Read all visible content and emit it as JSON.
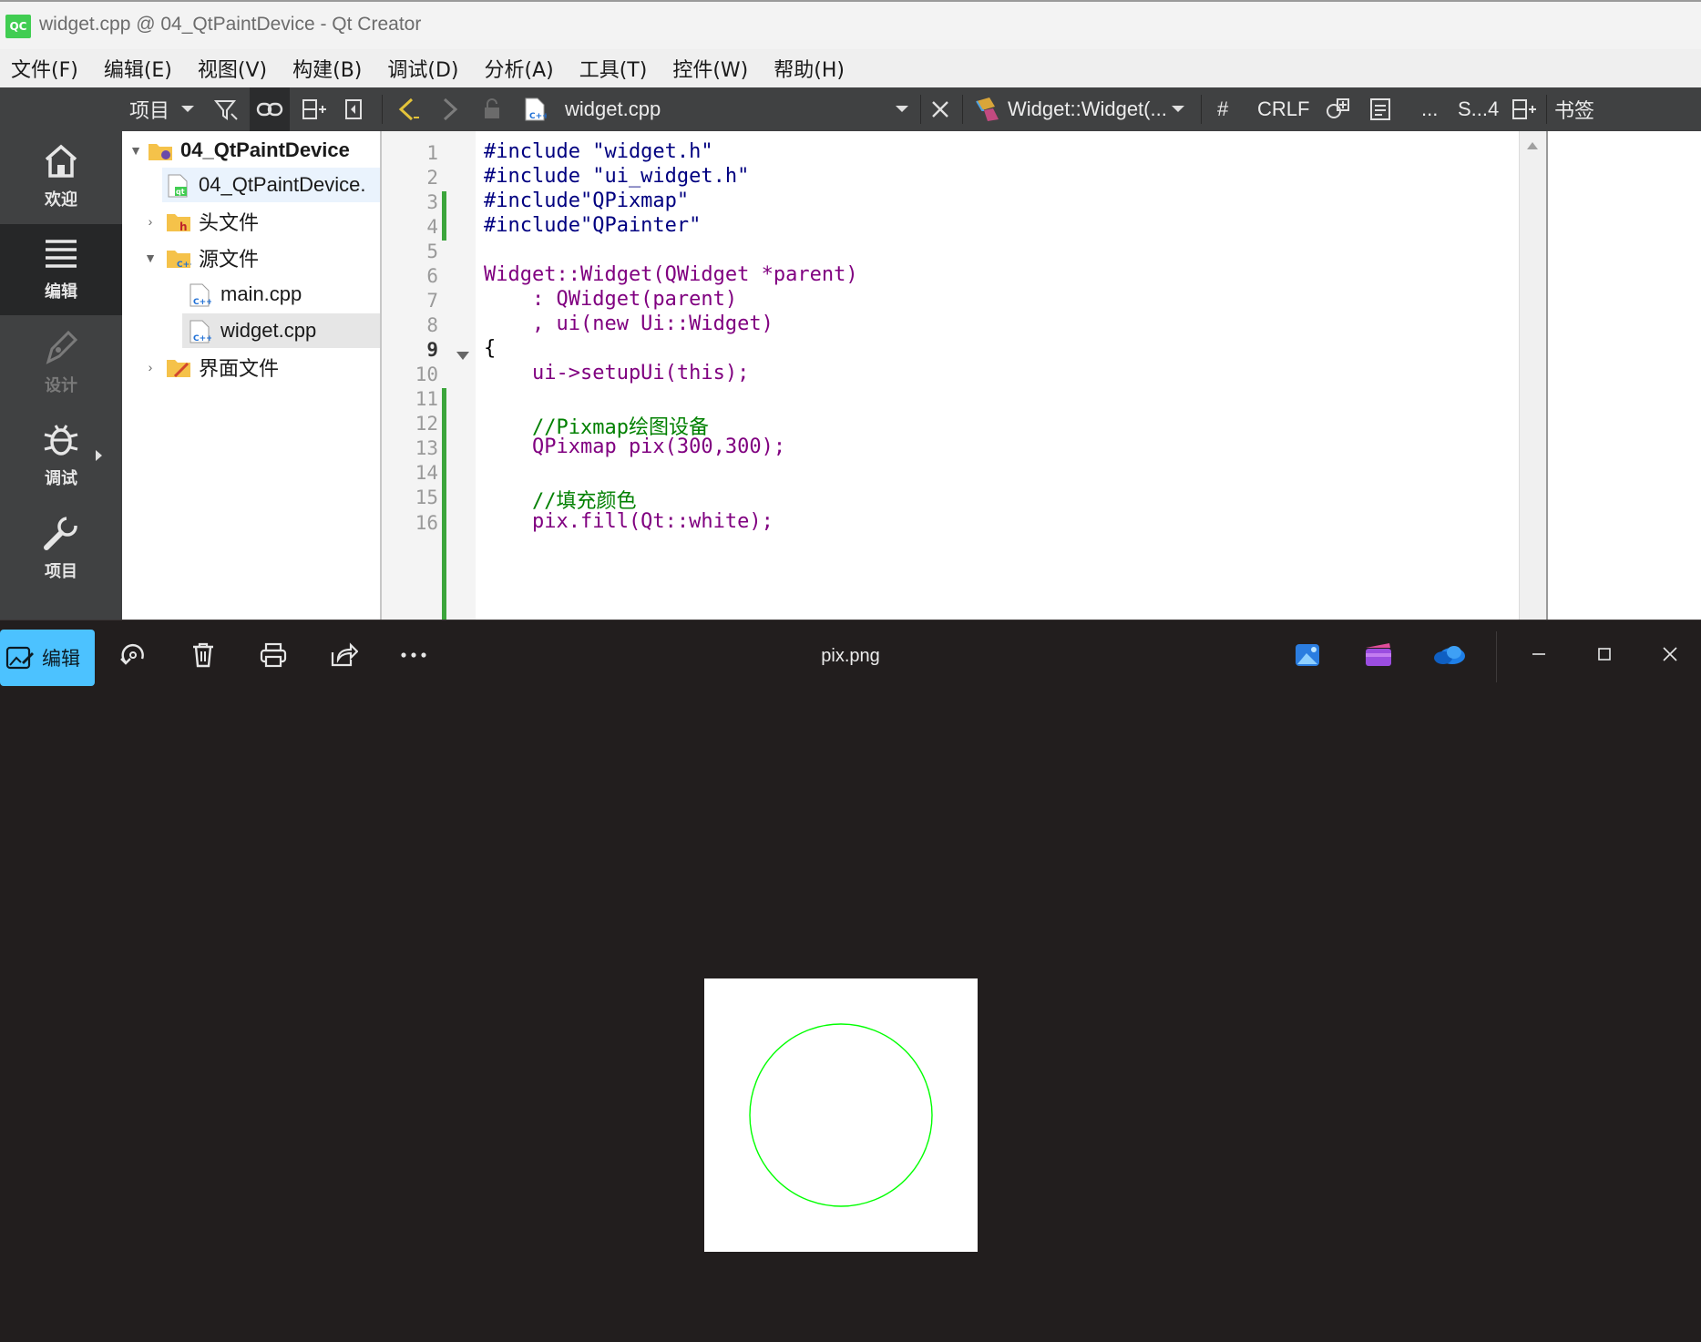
{
  "qt_creator": {
    "window_title": "widget.cpp @ 04_QtPaintDevice - Qt Creator",
    "logo_text": "QC",
    "menu": [
      "文件(F)",
      "编辑(E)",
      "视图(V)",
      "构建(B)",
      "调试(D)",
      "分析(A)",
      "工具(T)",
      "控件(W)",
      "帮助(H)"
    ],
    "toolbar": {
      "project_selector": "项目",
      "open_file": "widget.cpp",
      "symbol": "Widget::Widget(...",
      "hash": "#",
      "line_ending": "CRLF",
      "ellipsis": "...",
      "split": "S...4",
      "bookmarks": "书签"
    },
    "modes": [
      {
        "label": "欢迎",
        "icon": "home-icon"
      },
      {
        "label": "编辑",
        "icon": "edit-lines-icon"
      },
      {
        "label": "设计",
        "icon": "pen-icon"
      },
      {
        "label": "调试",
        "icon": "bug-icon"
      },
      {
        "label": "项目",
        "icon": "wrench-icon"
      }
    ],
    "project_tree": [
      {
        "label": "04_QtPaintDevice",
        "level": 0,
        "expanded": true,
        "icon": "project-folder-icon"
      },
      {
        "label": "04_QtPaintDevice.",
        "level": 1,
        "icon": "qt-pro-file-icon"
      },
      {
        "label": "头文件",
        "level": 1,
        "expanded": false,
        "icon": "header-folder-icon"
      },
      {
        "label": "源文件",
        "level": 1,
        "expanded": true,
        "icon": "source-folder-icon"
      },
      {
        "label": "main.cpp",
        "level": 2,
        "icon": "cpp-file-icon"
      },
      {
        "label": "widget.cpp",
        "level": 2,
        "icon": "cpp-file-icon",
        "selected": true
      },
      {
        "label": "界面文件",
        "level": 1,
        "expanded": false,
        "icon": "form-folder-icon"
      }
    ],
    "code": {
      "line_numbers": [
        "1",
        "2",
        "3",
        "4",
        "5",
        "6",
        "7",
        "8",
        "9",
        "10",
        "11",
        "12",
        "13",
        "14",
        "15",
        "16"
      ],
      "current_line": "9",
      "lines": [
        "#include \"widget.h\"",
        "#include \"ui_widget.h\"",
        "#include\"QPixmap\"",
        "#include\"QPainter\"",
        "",
        "Widget::Widget(QWidget *parent)",
        "    : QWidget(parent)",
        "    , ui(new Ui::Widget)",
        "{",
        "    ui->setupUi(this);",
        "",
        "    //Pixmap绘图设备",
        "    QPixmap pix(300,300);",
        "",
        "    //填充颜色",
        "    pix.fill(Qt::white);"
      ]
    }
  },
  "photos": {
    "edit_button": "编辑",
    "file_name": "pix.png",
    "image": {
      "width": 300,
      "height": 300,
      "background": "#ffffff",
      "circle_color": "#00ff00"
    }
  },
  "colors": {
    "qt_dark": "#404142",
    "photos_bg": "#221e1e",
    "accent": "#4cc2ff",
    "change_bar": "#3ba53b"
  }
}
